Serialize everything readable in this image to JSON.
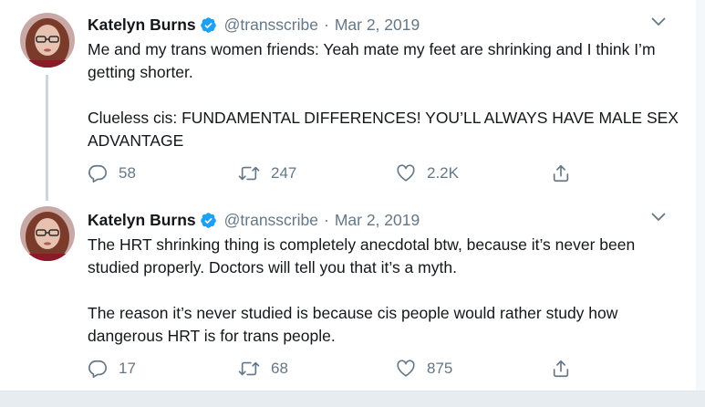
{
  "tweets": [
    {
      "author": {
        "name": "Katelyn Burns",
        "handle": "@transscribe",
        "verified": true
      },
      "separator": "·",
      "date": "Mar 2, 2019",
      "paragraphs": [
        "Me and my trans women friends: Yeah mate my feet are shrinking and I think I’m getting shorter.",
        "Clueless cis: FUNDAMENTAL DIFFERENCES! YOU’LL ALWAYS HAVE MALE SEX ADVANTAGE"
      ],
      "stats": {
        "replies": "58",
        "retweets": "247",
        "likes": "2.2K"
      }
    },
    {
      "author": {
        "name": "Katelyn Burns",
        "handle": "@transscribe",
        "verified": true
      },
      "separator": "·",
      "date": "Mar 2, 2019",
      "paragraphs": [
        "The HRT shrinking thing is completely anecdotal btw, because it’s never been studied properly. Doctors will tell you that it’s a myth.",
        "The reason it’s never studied is because cis people would rather study how dangerous HRT is for trans people."
      ],
      "stats": {
        "replies": "17",
        "retweets": "68",
        "likes": "875"
      }
    }
  ],
  "icons": {
    "verified": "verified-badge-icon",
    "menu": "chevron-down-icon",
    "reply": "reply-icon",
    "retweet": "retweet-icon",
    "like": "heart-icon",
    "share": "share-icon"
  },
  "colors": {
    "verified": "#1da1f2",
    "secondary_text": "#657786",
    "thread_line": "#ccd6dd"
  }
}
